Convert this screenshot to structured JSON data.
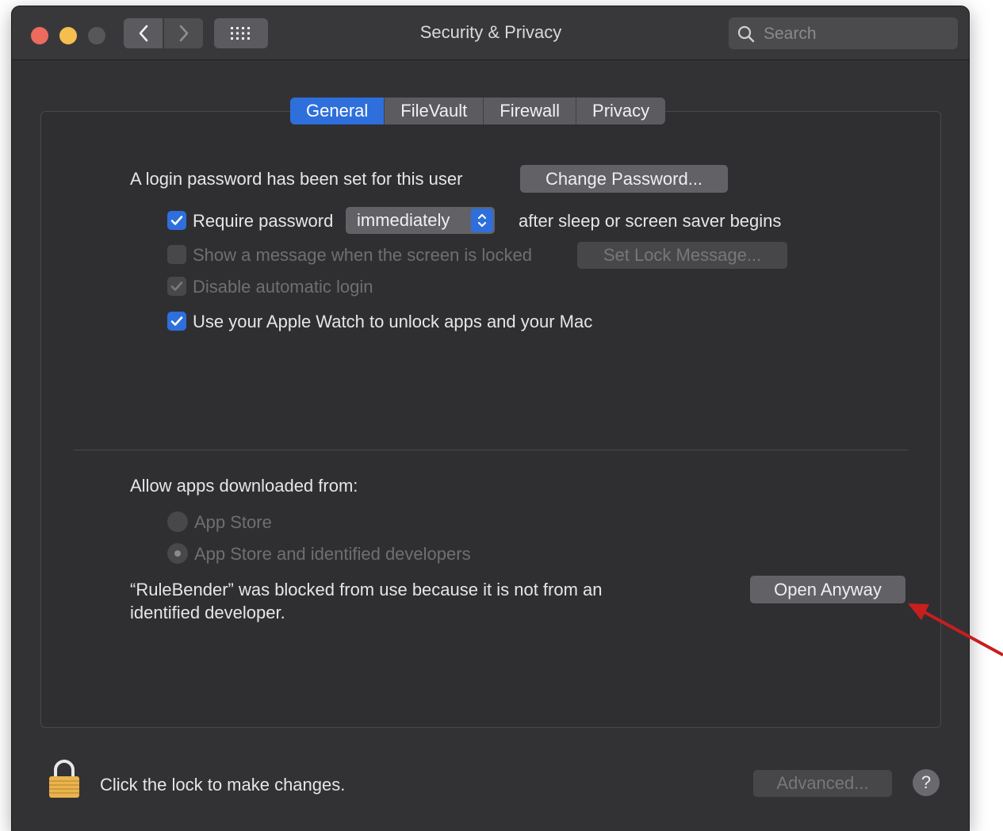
{
  "window": {
    "title": "Security & Privacy"
  },
  "search": {
    "placeholder": "Search"
  },
  "tabs": [
    {
      "label": "General",
      "active": true
    },
    {
      "label": "FileVault",
      "active": false
    },
    {
      "label": "Firewall",
      "active": false
    },
    {
      "label": "Privacy",
      "active": false
    }
  ],
  "general": {
    "login_text": "A login password has been set for this user",
    "change_password_label": "Change Password...",
    "require_password_label": "Require password",
    "require_password_checked": true,
    "require_password_delay": "immediately",
    "after_sleep_text": "after sleep or screen saver begins",
    "show_message_label": "Show a message when the screen is locked",
    "show_message_checked": false,
    "set_lock_message_label": "Set Lock Message...",
    "disable_auto_login_label": "Disable automatic login",
    "disable_auto_login_checked": true,
    "apple_watch_label": "Use your Apple Watch to unlock apps and your Mac",
    "apple_watch_checked": true
  },
  "allow_apps": {
    "heading": "Allow apps downloaded from:",
    "options": [
      {
        "label": "App Store",
        "selected": false
      },
      {
        "label": "App Store and identified developers",
        "selected": true
      }
    ],
    "blocked_line1": "“RuleBender” was blocked from use because it is not from an",
    "blocked_line2": "identified developer.",
    "open_anyway_label": "Open Anyway"
  },
  "footer": {
    "lock_text": "Click the lock to make changes.",
    "advanced_label": "Advanced...",
    "help_label": "?"
  },
  "colors": {
    "accent": "#2e6fdc",
    "annotation_arrow": "#c81e1e"
  },
  "icons": [
    "back-chevron-icon",
    "forward-chevron-icon",
    "grid-icon",
    "search-icon",
    "checkmark-icon",
    "popup-arrows-icon",
    "lock-icon",
    "help-icon",
    "annotation-arrow"
  ]
}
